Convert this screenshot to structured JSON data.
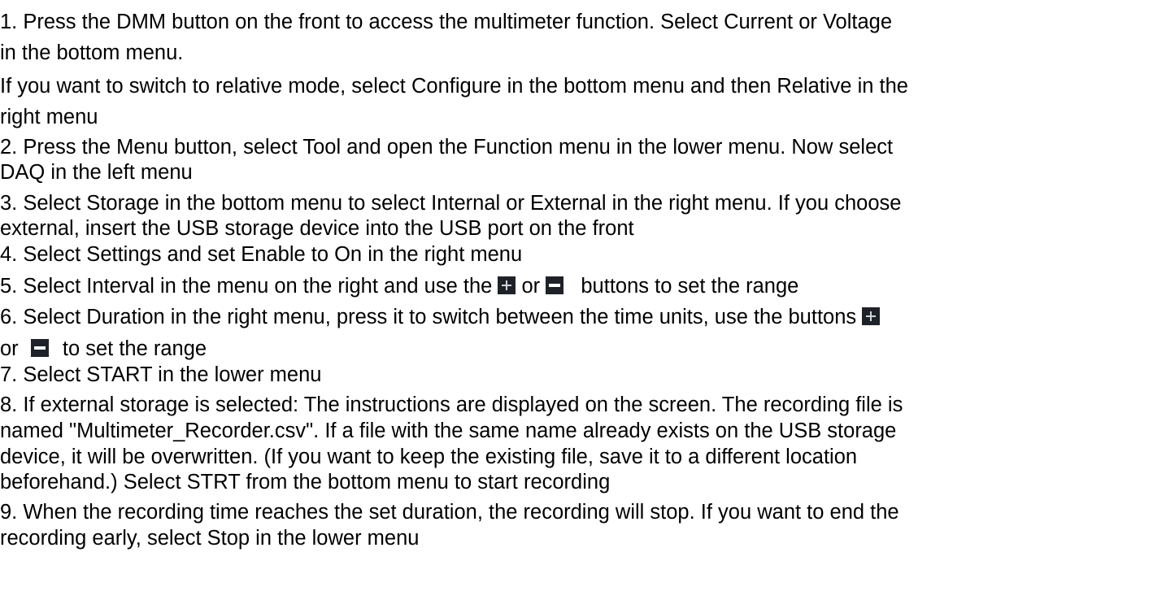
{
  "steps": [
    "1. Press the DMM button on the front to access the multimeter function. Select Current or Voltage",
    "in the bottom menu.",
    "If you want to switch to relative mode, select Configure in the bottom menu and then Relative in the",
    "right menu",
    "2. Press the Menu button, select Tool and open the Function menu in the lower menu. Now select",
    "DAQ in the left menu",
    "3. Select Storage in the bottom menu to select Internal or External in the right menu. If you choose",
    "external, insert the USB storage device into the USB port on the front",
    "4. Select Settings and set Enable to On in the right menu",
    "5. Select Interval in the menu on the right and use the",
    "or",
    "buttons to set the range",
    "6. Select Duration in the right menu, press it to switch between the time units, use the buttons",
    "or",
    "to set the range",
    "7. Select START in the lower menu",
    "8. If external storage is selected: The instructions are displayed on the screen. The recording file is",
    "named \"Multimeter_Recorder.csv\". If a file with the same name already exists on the USB storage",
    "device, it will be overwritten. (If you want to keep the existing file, save it to a different location",
    "beforehand.) Select STRT from the bottom menu to start recording",
    "9. When the recording time reaches the set duration, the recording will stop. If you want to end the",
    "recording early, select Stop in the lower menu"
  ],
  "icons": {
    "plus": "plus-button-icon",
    "minus": "minus-button-icon"
  }
}
